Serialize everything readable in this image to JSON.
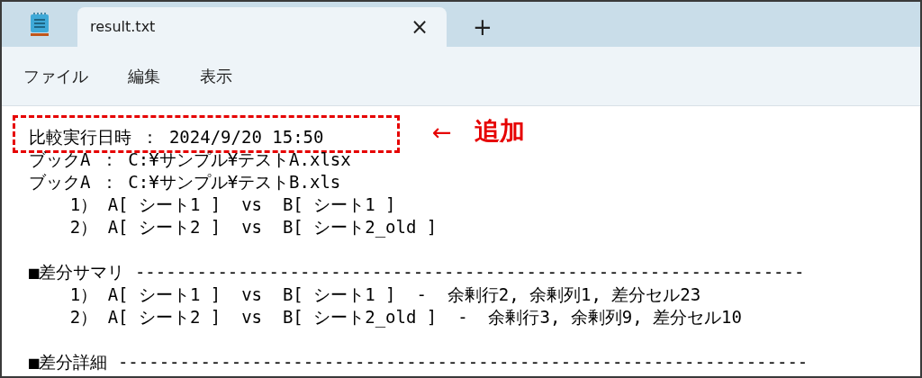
{
  "tabs": [
    {
      "title": "result.txt",
      "selected": true,
      "close": "×"
    }
  ],
  "new_tab": "+",
  "menu": [
    "ファイル",
    "編集",
    "表示"
  ],
  "blocks": [
    [
      {
        "text": "比較実行日時 ： 2024/9/20 15:50",
        "annotated": true
      },
      {
        "text": "ブックA ： C:¥サンプル¥テストA.xlsx",
        "annotated": false
      },
      {
        "text": "ブックA ： C:¥サンプル¥テストB.xls",
        "annotated": false
      },
      {
        "text": "    1） A[ シート1 ]  vs  B[ シート1 ]",
        "annotated": false
      },
      {
        "text": "    2） A[ シート2 ]  vs  B[ シート2_old ]",
        "annotated": false
      }
    ],
    [
      {
        "text": "■差分サマリ -----------------------------------------------------------------",
        "annotated": false
      },
      {
        "text": "    1） A[ シート1 ]  vs  B[ シート1 ]  -  余剰行2, 余剰列1, 差分セル23",
        "annotated": false
      },
      {
        "text": "    2） A[ シート2 ]  vs  B[ シート2_old ]  -  余剰行3, 余剰列9, 差分セル10",
        "annotated": false
      }
    ],
    [
      {
        "text": "■差分詳細 -------------------------------------------------------------------",
        "annotated": false
      }
    ]
  ],
  "annotation": {
    "arrow": "←",
    "label": "追加"
  }
}
